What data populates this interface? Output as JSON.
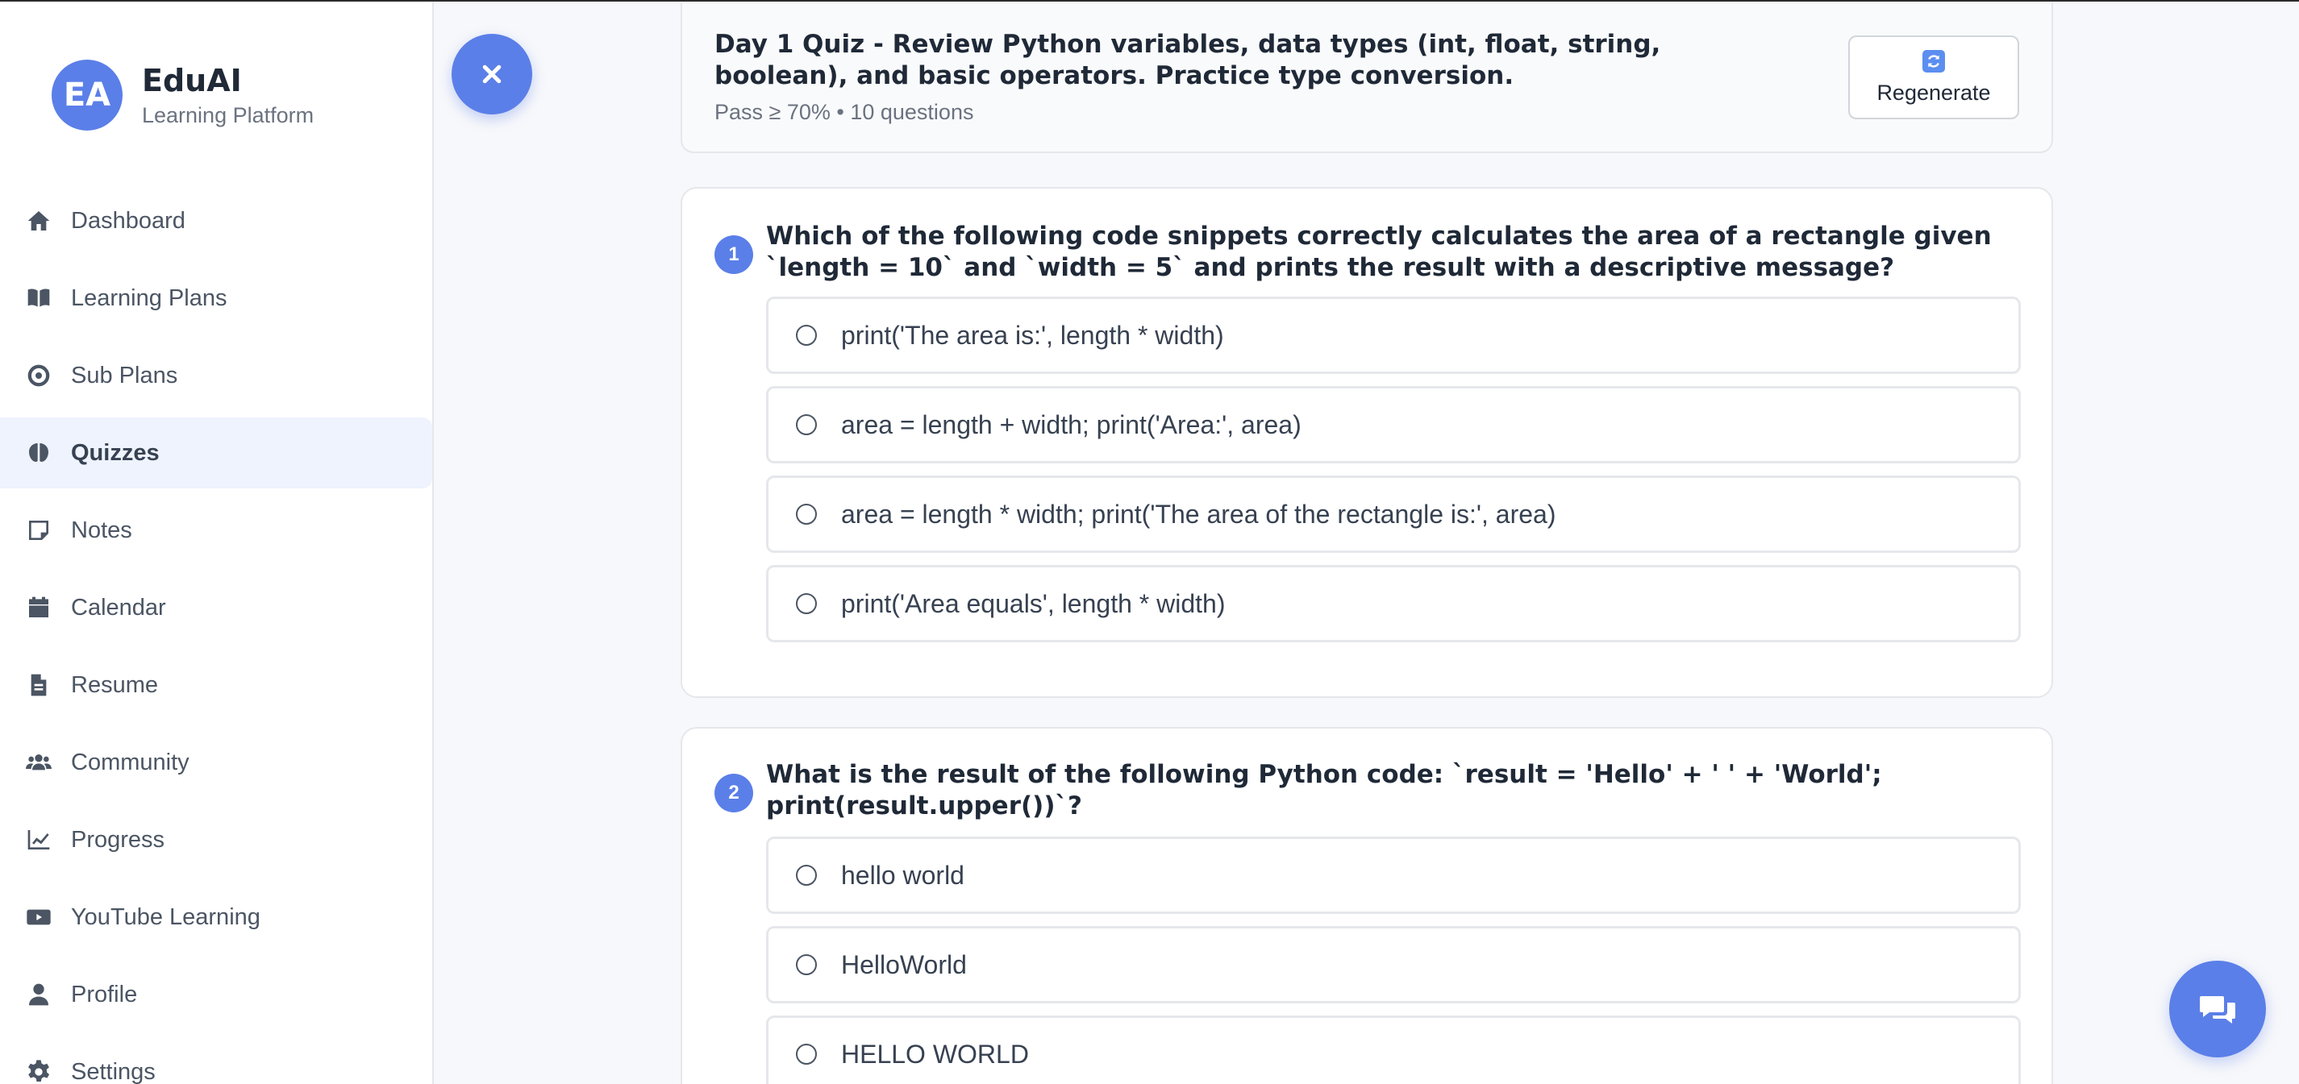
{
  "brand": {
    "initials": "EA",
    "name": "EduAI",
    "subtitle": "Learning Platform"
  },
  "sidebar": {
    "items": [
      {
        "label": "Dashboard",
        "icon": "home-icon",
        "active": false
      },
      {
        "label": "Learning Plans",
        "icon": "book-icon",
        "active": false
      },
      {
        "label": "Sub Plans",
        "icon": "target-icon",
        "active": false
      },
      {
        "label": "Quizzes",
        "icon": "brain-icon",
        "active": true
      },
      {
        "label": "Notes",
        "icon": "note-icon",
        "active": false
      },
      {
        "label": "Calendar",
        "icon": "calendar-icon",
        "active": false
      },
      {
        "label": "Resume",
        "icon": "document-icon",
        "active": false
      },
      {
        "label": "Community",
        "icon": "users-icon",
        "active": false
      },
      {
        "label": "Progress",
        "icon": "chart-line-icon",
        "active": false
      },
      {
        "label": "YouTube Learning",
        "icon": "youtube-icon",
        "active": false
      },
      {
        "label": "Profile",
        "icon": "user-icon",
        "active": false
      },
      {
        "label": "Settings",
        "icon": "gear-icon",
        "active": false
      }
    ]
  },
  "quiz": {
    "title": "Day 1 Quiz - Review Python variables, data types (int, float, string, boolean), and basic operators. Practice type conversion.",
    "meta": "Pass ≥ 70% • 10 questions",
    "regenerate_label": "Regenerate"
  },
  "questions": [
    {
      "number": "1",
      "text": "Which of the following code snippets correctly calculates the area of a rectangle given `length = 10` and `width = 5` and prints the result with a descriptive message?",
      "options": [
        "print('The area is:', length * width)",
        "area = length + width; print('Area:', area)",
        "area = length * width; print('The area of the rectangle is:', area)",
        "print('Area equals', length * width)"
      ]
    },
    {
      "number": "2",
      "text": "What is the result of the following Python code: `result = 'Hello' + ' ' + 'World'; print(result.upper())`?",
      "options": [
        "hello world",
        "HelloWorld",
        "HELLO WORLD"
      ]
    }
  ],
  "colors": {
    "accent": "#5b7fe8",
    "active_bg": "#eef3fd",
    "page_bg": "#f7f8fb"
  }
}
